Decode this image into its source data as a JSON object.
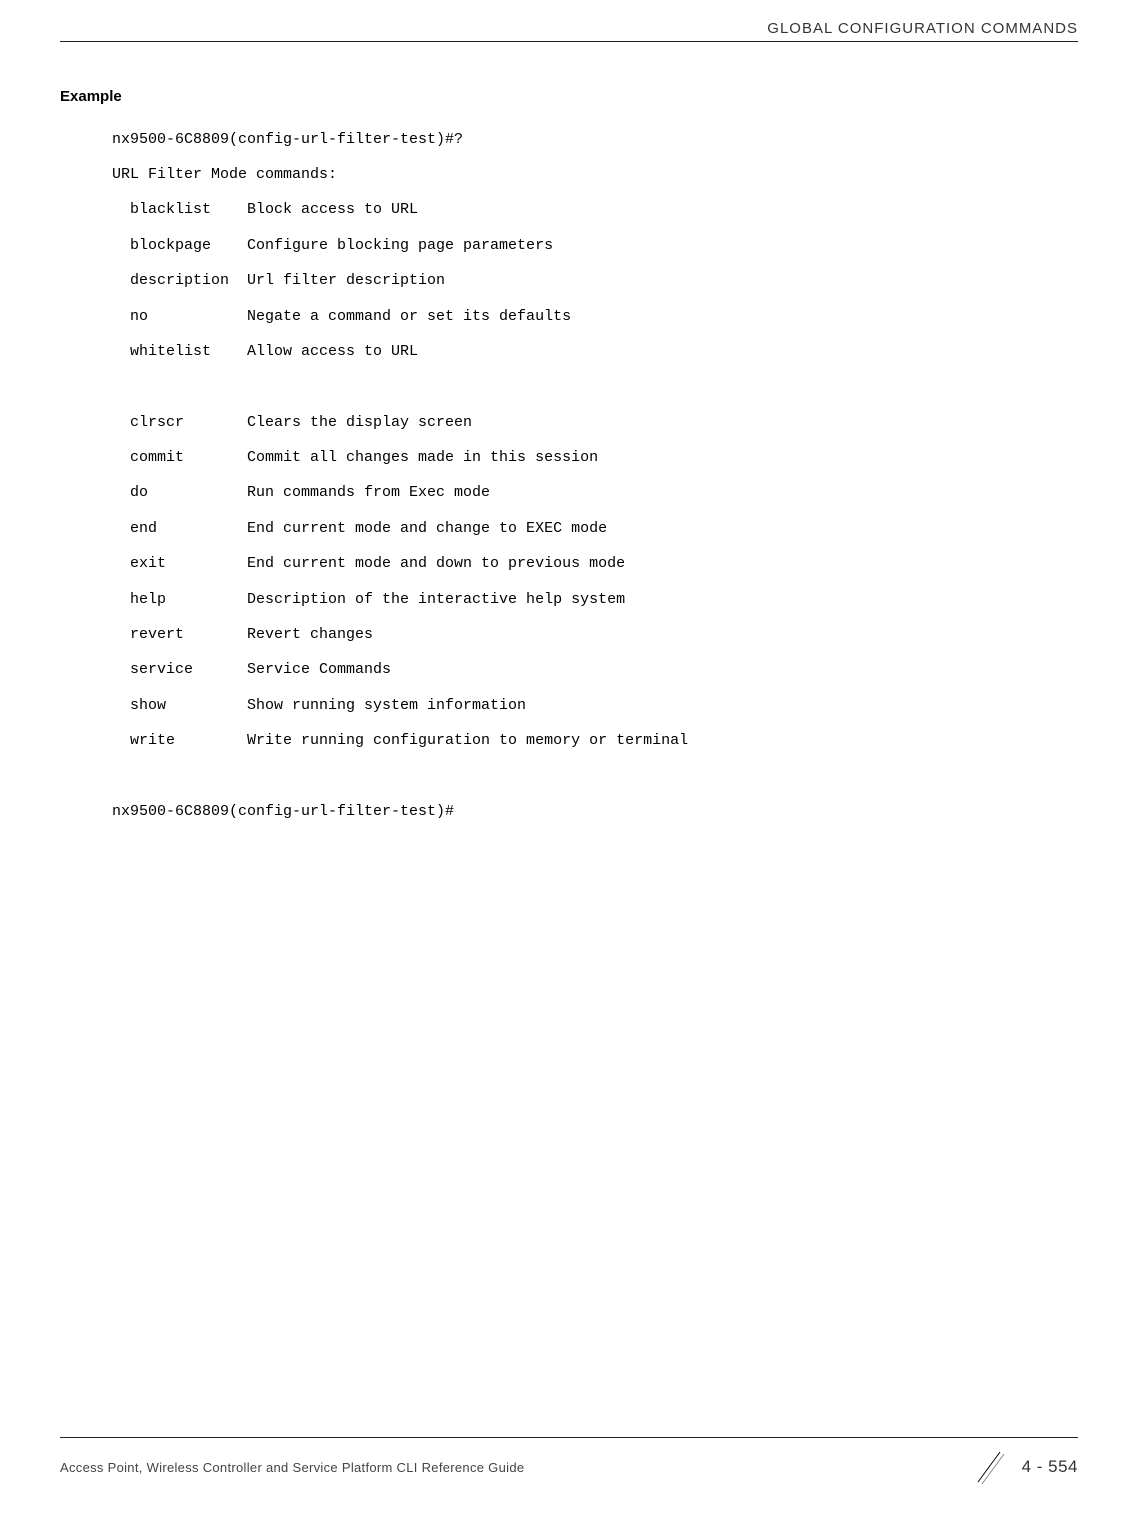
{
  "header": {
    "title": "GLOBAL CONFIGURATION COMMANDS"
  },
  "example": {
    "heading": "Example",
    "prompt1": "nx9500-6C8809(config-url-filter-test)#?",
    "mode_line": "URL Filter Mode commands:",
    "group1": [
      {
        "cmd": "blacklist",
        "desc": "Block access to URL"
      },
      {
        "cmd": "blockpage",
        "desc": "Configure blocking page parameters"
      },
      {
        "cmd": "description",
        "desc": "Url filter description"
      },
      {
        "cmd": "no",
        "desc": "Negate a command or set its defaults"
      },
      {
        "cmd": "whitelist",
        "desc": "Allow access to URL"
      }
    ],
    "group2": [
      {
        "cmd": "clrscr",
        "desc": "Clears the display screen"
      },
      {
        "cmd": "commit",
        "desc": "Commit all changes made in this session"
      },
      {
        "cmd": "do",
        "desc": "Run commands from Exec mode"
      },
      {
        "cmd": "end",
        "desc": "End current mode and change to EXEC mode"
      },
      {
        "cmd": "exit",
        "desc": "End current mode and down to previous mode"
      },
      {
        "cmd": "help",
        "desc": "Description of the interactive help system"
      },
      {
        "cmd": "revert",
        "desc": "Revert changes"
      },
      {
        "cmd": "service",
        "desc": "Service Commands"
      },
      {
        "cmd": "show",
        "desc": "Show running system information"
      },
      {
        "cmd": "write",
        "desc": "Write running configuration to memory or terminal"
      }
    ],
    "prompt2": "nx9500-6C8809(config-url-filter-test)#"
  },
  "footer": {
    "left": "Access Point, Wireless Controller and Service Platform CLI Reference Guide",
    "page": "4 - 554"
  }
}
